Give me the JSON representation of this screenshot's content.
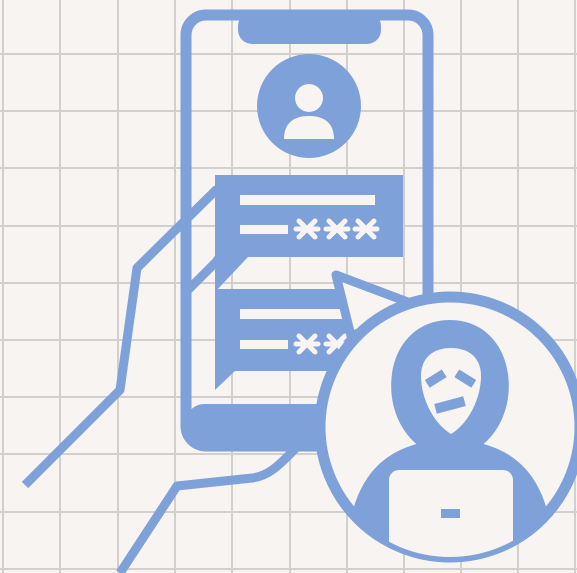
{
  "colors": {
    "background": "#f7f4f1",
    "grid": "#d2d0cd",
    "icon": "#7ea1da"
  },
  "icons": {
    "illustration": "smartphone-chat-scam-icon",
    "phone": "smartphone-icon",
    "avatar": "user-avatar-icon",
    "hacker": "hooded-hacker-icon",
    "hand": "hand-outline-icon"
  },
  "messages": [
    {
      "masked": "***"
    },
    {
      "masked": "***"
    }
  ]
}
